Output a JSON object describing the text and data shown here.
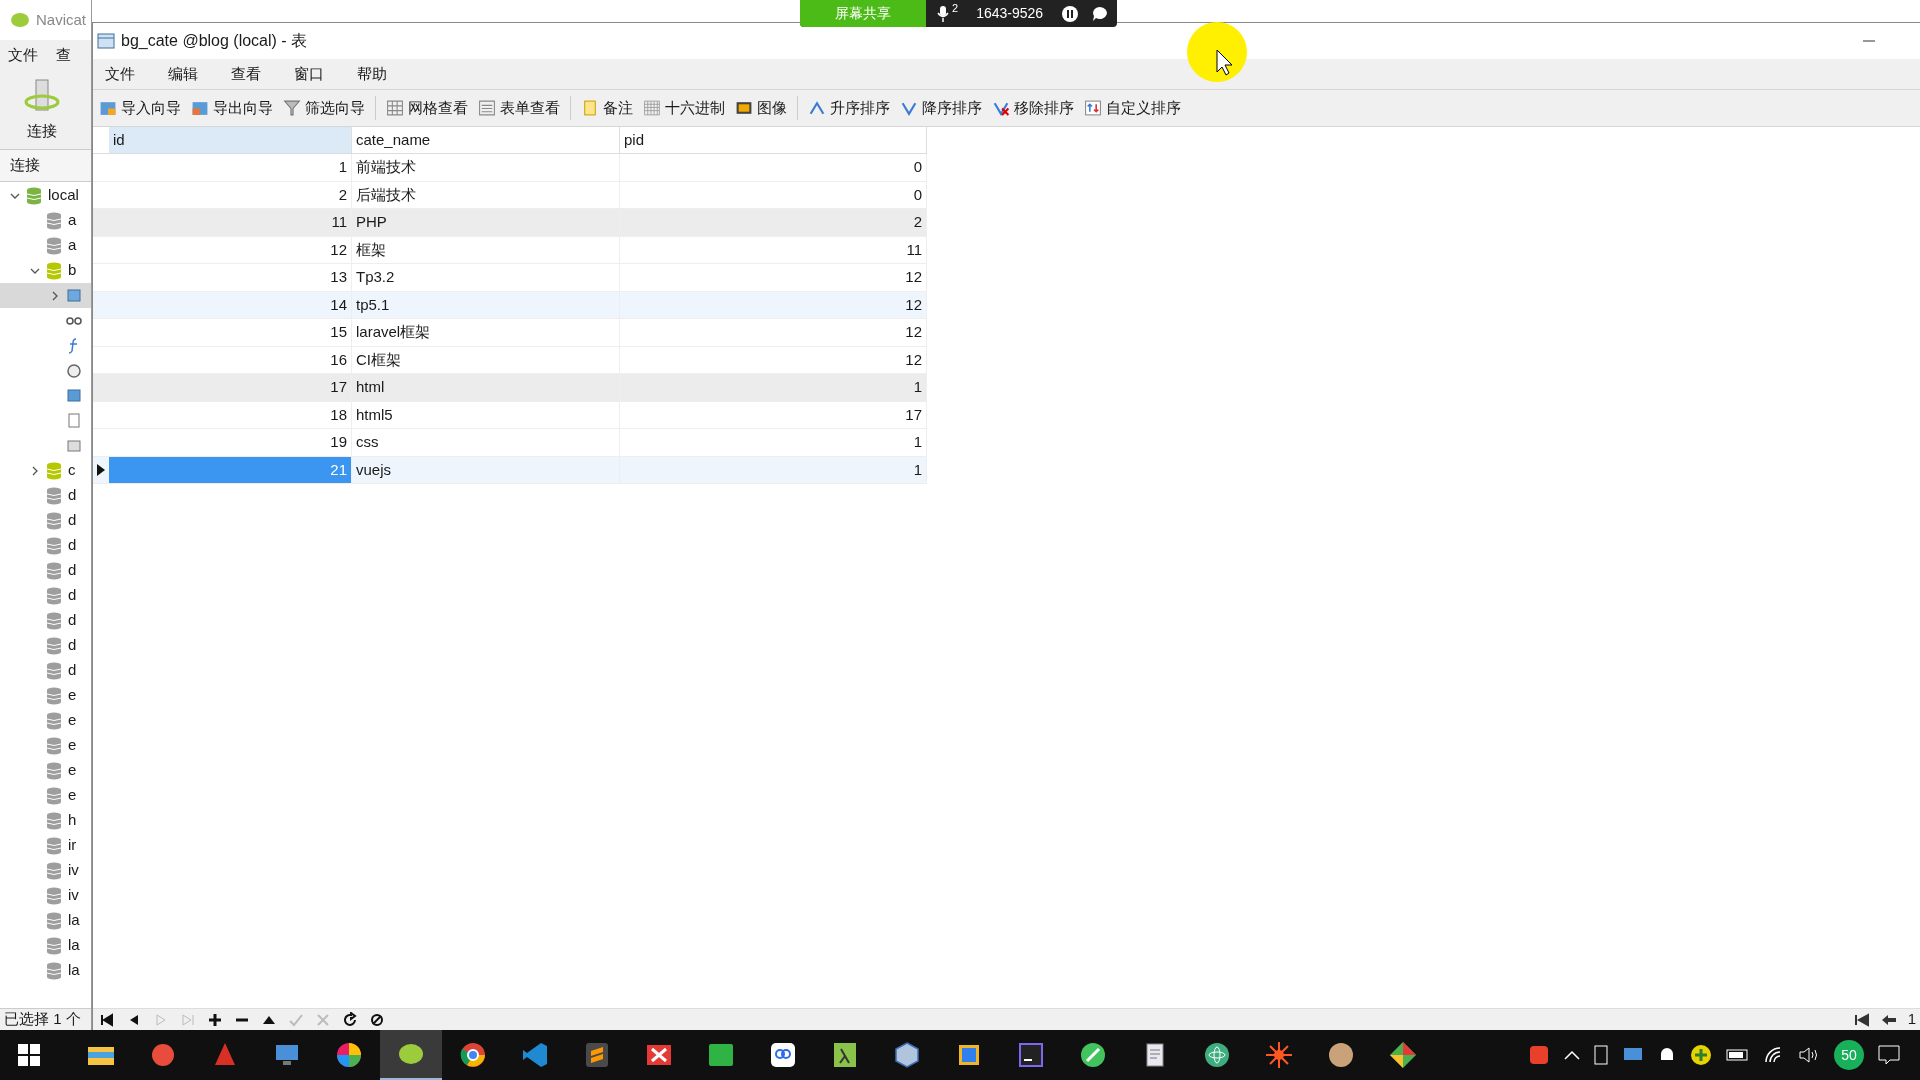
{
  "background_window": {
    "title": "Navicat",
    "menu": [
      "文件",
      "查"
    ],
    "connect_button": "连接",
    "panel_title": "连接",
    "tree": [
      {
        "label": "local",
        "kind": "connection",
        "expanded": true,
        "children": [
          {
            "label": "a",
            "kind": "db"
          },
          {
            "label": "a",
            "kind": "db"
          },
          {
            "label": "b",
            "kind": "db_open",
            "expanded": true,
            "children": [
              {
                "kind": "tables",
                "expanded": false,
                "selected": true
              },
              {
                "kind": "views",
                "selected": false
              },
              {
                "kind": "functions",
                "selected": false
              },
              {
                "kind": "events",
                "selected": false
              },
              {
                "kind": "queries",
                "selected": false
              },
              {
                "kind": "reports",
                "selected": false
              },
              {
                "kind": "backups",
                "selected": false
              }
            ]
          },
          {
            "label": "c",
            "kind": "db_open",
            "expanded": false
          },
          {
            "label": "d",
            "kind": "db"
          },
          {
            "label": "d",
            "kind": "db"
          },
          {
            "label": "d",
            "kind": "db"
          },
          {
            "label": "d",
            "kind": "db"
          },
          {
            "label": "d",
            "kind": "db"
          },
          {
            "label": "d",
            "kind": "db"
          },
          {
            "label": "d",
            "kind": "db"
          },
          {
            "label": "d",
            "kind": "db"
          },
          {
            "label": "e",
            "kind": "db"
          },
          {
            "label": "e",
            "kind": "db"
          },
          {
            "label": "e",
            "kind": "db"
          },
          {
            "label": "e",
            "kind": "db"
          },
          {
            "label": "e",
            "kind": "db"
          },
          {
            "label": "h",
            "kind": "db"
          },
          {
            "label": "ir",
            "kind": "db"
          },
          {
            "label": "iv",
            "kind": "db"
          },
          {
            "label": "iv",
            "kind": "db"
          },
          {
            "label": "la",
            "kind": "db"
          },
          {
            "label": "la",
            "kind": "db"
          },
          {
            "label": "la",
            "kind": "db"
          }
        ]
      }
    ],
    "status": "已选择 1 个"
  },
  "screen_share": {
    "label": "屏幕共享",
    "mic_count": "2",
    "meeting_id": "1643-9526"
  },
  "window": {
    "title": "bg_cate @blog (local) - 表"
  },
  "menu": [
    "文件",
    "编辑",
    "查看",
    "窗口",
    "帮助"
  ],
  "toolbar": [
    {
      "label": "导入向导",
      "kind": "import"
    },
    {
      "label": "导出向导",
      "kind": "export"
    },
    {
      "label": "筛选向导",
      "kind": "filter"
    },
    {
      "kind": "separator"
    },
    {
      "label": "网格查看",
      "kind": "grid"
    },
    {
      "label": "表单查看",
      "kind": "form"
    },
    {
      "kind": "separator"
    },
    {
      "label": "备注",
      "kind": "memo"
    },
    {
      "label": "十六进制",
      "kind": "hex"
    },
    {
      "label": "图像",
      "kind": "image"
    },
    {
      "kind": "separator"
    },
    {
      "label": "升序排序",
      "kind": "sort_asc"
    },
    {
      "label": "降序排序",
      "kind": "sort_desc"
    },
    {
      "label": "移除排序",
      "kind": "sort_remove"
    },
    {
      "label": "自定义排序",
      "kind": "sort_custom"
    }
  ],
  "table": {
    "columns": [
      "id",
      "cate_name",
      "pid"
    ],
    "rows": [
      {
        "cells": [
          "1",
          "前端技术",
          "0"
        ],
        "selected": false,
        "shaded": false,
        "hovered": false
      },
      {
        "cells": [
          "2",
          "后端技术",
          "0"
        ],
        "selected": false,
        "shaded": false,
        "hovered": false
      },
      {
        "cells": [
          "11",
          "PHP",
          "2"
        ],
        "selected": false,
        "shaded": true,
        "hovered": false
      },
      {
        "cells": [
          "12",
          "框架",
          "11"
        ],
        "selected": false,
        "shaded": false,
        "hovered": false
      },
      {
        "cells": [
          "13",
          "Tp3.2",
          "12"
        ],
        "selected": false,
        "shaded": false,
        "hovered": false
      },
      {
        "cells": [
          "14",
          "tp5.1",
          "12"
        ],
        "selected": false,
        "shaded": false,
        "hovered": true
      },
      {
        "cells": [
          "15",
          "laravel框架",
          "12"
        ],
        "selected": false,
        "shaded": false,
        "hovered": false
      },
      {
        "cells": [
          "16",
          "CI框架",
          "12"
        ],
        "selected": false,
        "shaded": false,
        "hovered": false
      },
      {
        "cells": [
          "17",
          "html",
          "1"
        ],
        "selected": false,
        "shaded": true,
        "hovered": false
      },
      {
        "cells": [
          "18",
          "html5",
          "17"
        ],
        "selected": false,
        "shaded": false,
        "hovered": false
      },
      {
        "cells": [
          "19",
          "css",
          "1"
        ],
        "selected": false,
        "shaded": false,
        "hovered": false
      },
      {
        "cells": [
          "21",
          "vuejs",
          "1"
        ],
        "selected": true,
        "shaded": false,
        "hovered": false
      }
    ]
  },
  "record_nav": [
    {
      "kind": "first",
      "disabled": false
    },
    {
      "kind": "prev",
      "disabled": false
    },
    {
      "kind": "next",
      "disabled": true
    },
    {
      "kind": "last",
      "disabled": true
    },
    {
      "kind": "add",
      "disabled": false
    },
    {
      "kind": "delete",
      "disabled": false
    },
    {
      "kind": "up",
      "disabled": false
    },
    {
      "kind": "apply",
      "disabled": true
    },
    {
      "kind": "discard",
      "disabled": true
    },
    {
      "kind": "refresh",
      "disabled": false
    },
    {
      "kind": "stop",
      "disabled": false
    }
  ],
  "page_indicator": "1",
  "taskbar": [
    {
      "kind": "files",
      "active": false
    },
    {
      "kind": "shell",
      "active": false
    },
    {
      "kind": "tool",
      "active": false
    },
    {
      "kind": "remote",
      "active": false
    },
    {
      "kind": "color",
      "active": false
    },
    {
      "kind": "navicat",
      "active": true
    },
    {
      "kind": "browser",
      "active": false
    },
    {
      "kind": "code",
      "active": false
    },
    {
      "kind": "sublime",
      "active": false
    },
    {
      "kind": "xmind",
      "active": false
    },
    {
      "kind": "sheet",
      "active": false
    },
    {
      "kind": "cloud",
      "active": false
    },
    {
      "kind": "lambda",
      "active": false
    },
    {
      "kind": "cube",
      "active": false
    },
    {
      "kind": "box",
      "active": false
    },
    {
      "kind": "go",
      "active": false
    },
    {
      "kind": "pen",
      "active": false
    },
    {
      "kind": "docs",
      "active": false
    },
    {
      "kind": "atom",
      "active": false
    },
    {
      "kind": "sun",
      "active": false
    },
    {
      "kind": "avatar",
      "active": false
    },
    {
      "kind": "git",
      "active": false
    }
  ],
  "tray_badge": "50"
}
